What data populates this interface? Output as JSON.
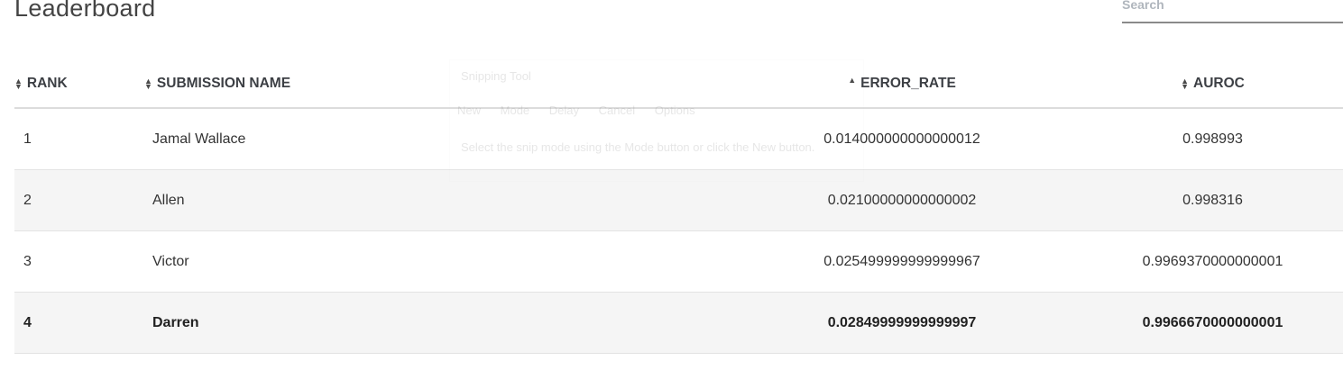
{
  "page": {
    "title": "Leaderboard"
  },
  "search": {
    "placeholder": "Search"
  },
  "table": {
    "columns": [
      {
        "label": "RANK",
        "sort_icon": "sort-both-icon",
        "sort_glyph": "⬍"
      },
      {
        "label": "SUBMISSION NAME",
        "sort_icon": "sort-both-icon",
        "sort_glyph": "⬍"
      },
      {
        "label": "ERROR_RATE",
        "sort_icon": "sort-ascending-icon",
        "sort_glyph": "▲"
      },
      {
        "label": "AUROC",
        "sort_icon": "sort-both-icon",
        "sort_glyph": "⬍"
      }
    ],
    "rows": [
      {
        "rank": "1",
        "name": "Jamal Wallace",
        "error_rate": "0.014000000000000012",
        "auroc": "0.998993"
      },
      {
        "rank": "2",
        "name": "Allen",
        "error_rate": "0.02100000000000002",
        "auroc": "0.998316"
      },
      {
        "rank": "3",
        "name": "Victor",
        "error_rate": "0.025499999999999967",
        "auroc": "0.9969370000000001"
      },
      {
        "rank": "4",
        "name": "Darren",
        "error_rate": "0.02849999999999997",
        "auroc": "0.9966670000000001"
      }
    ]
  },
  "overlay": {
    "title": "Snipping Tool",
    "toolbar": [
      "New",
      "Mode",
      "Delay",
      "Cancel",
      "Options"
    ],
    "message": "Select the snip mode using the Mode button or click the New button."
  }
}
